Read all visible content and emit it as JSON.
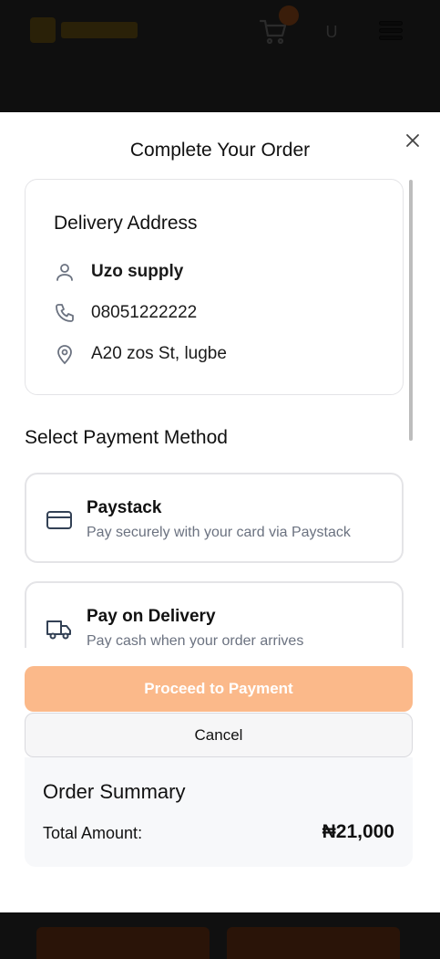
{
  "background": {
    "header": {
      "user_initial": "U"
    }
  },
  "modal": {
    "title": "Complete Your Order",
    "address": {
      "title": "Delivery Address",
      "name": "Uzo supply",
      "phone": "08051222222",
      "street": "A20 zos St, lugbe"
    },
    "payment": {
      "heading": "Select Payment Method",
      "methods": [
        {
          "name": "Paystack",
          "description": "Pay securely with your card via Paystack",
          "icon": "credit-card-icon"
        },
        {
          "name": "Pay on Delivery",
          "description": "Pay cash when your order arrives",
          "icon": "truck-icon"
        }
      ]
    },
    "proceed_label": "Proceed to Payment",
    "cancel_label": "Cancel",
    "summary": {
      "title": "Order Summary",
      "total_label": "Total Amount:",
      "total_value": "₦21,000"
    }
  },
  "colors": {
    "accent": "#fbb98a",
    "overlay": "#0d0d0d",
    "muted_text": "#6b7280"
  }
}
